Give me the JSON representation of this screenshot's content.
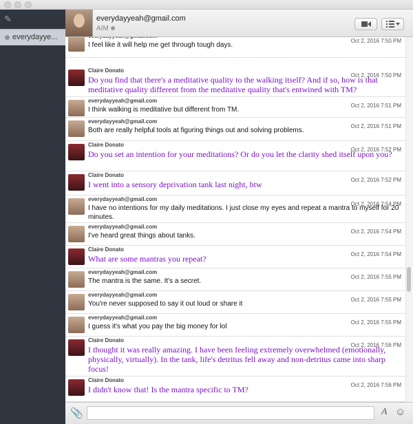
{
  "contact": {
    "name": "everydayyeah@gmail.com",
    "service": "AIM"
  },
  "sidebar": {
    "compose_icon": "compose-icon",
    "buddy": "everydayye..."
  },
  "header": {
    "video_icon": "video-camera-icon",
    "menu_icon": "list-menu-icon"
  },
  "colors": {
    "claire_text": "#7b10c7",
    "sidebar_bg": "#2f3640"
  },
  "messages": [
    {
      "sender": "everydayyeah@gmail.com",
      "time": "Oct 2, 2016 7:50 PM",
      "text": "I feel like it will help me get through tough days."
    },
    {
      "sender": "Claire Donato",
      "time": "Oct 2, 2016 7:50 PM",
      "text": "Do you find that there's a meditative quality to the walking itself? And if so, how is that meditative quality different from the meditative quality that's entwined with TM?"
    },
    {
      "sender": "everydayyeah@gmail.com",
      "time": "Oct 2, 2016 7:51 PM",
      "text": " I think walking is meditative but different from TM."
    },
    {
      "sender": "everydayyeah@gmail.com",
      "time": "Oct 2, 2016 7:51 PM",
      "text": "Both are really helpful tools at figuring things out and solving problems."
    },
    {
      "sender": "Claire Donato",
      "time": "Oct 2, 2016 7:52 PM",
      "text": "Do you set an intention for your meditations? Or do you let the clarity shed itself upon you?"
    },
    {
      "sender": "Claire Donato",
      "time": "Oct 2, 2016 7:52 PM",
      "text": "I went into a sensory deprivation tank last night, btw"
    },
    {
      "sender": "everydayyeah@gmail.com",
      "time": "Oct 2, 2016 7:54 PM",
      "text": "I have no intentions for my daily meditations. I just close my eyes and repeat a mantra to myself for 20 minutes."
    },
    {
      "sender": "everydayyeah@gmail.com",
      "time": "Oct 2, 2016 7:54 PM",
      "text": "I've heard great things about tanks."
    },
    {
      "sender": "Claire Donato",
      "time": "Oct 2, 2016 7:54 PM",
      "text": "What are some mantras you repeat?"
    },
    {
      "sender": "everydayyeah@gmail.com",
      "time": "Oct 2, 2016 7:55 PM",
      "text": "The mantra is the same. It's a secret."
    },
    {
      "sender": "everydayyeah@gmail.com",
      "time": "Oct 2, 2016 7:55 PM",
      "text": "You're never supposed to say it out loud or share it"
    },
    {
      "sender": "everydayyeah@gmail.com",
      "time": "Oct 2, 2016 7:55 PM",
      "text": "I guess it's what you pay the big money for lol"
    },
    {
      "sender": "Claire Donato",
      "time": "Oct 2, 2016 7:56 PM",
      "text": "I thought it was really amazing. I have been feeling extremely overwhelmed (emotionally, physically, virtually). In the tank, life's detritus fell away and non-detritus came into sharp focus!"
    },
    {
      "sender": "Claire Donato",
      "time": "Oct 2, 2016 7:56 PM",
      "text": "I didn't know that! Is the mantra specific to TM?"
    }
  ],
  "composer": {
    "attach_icon": "paperclip-icon",
    "font_label": "A",
    "emoji_icon": "smiley-icon"
  }
}
